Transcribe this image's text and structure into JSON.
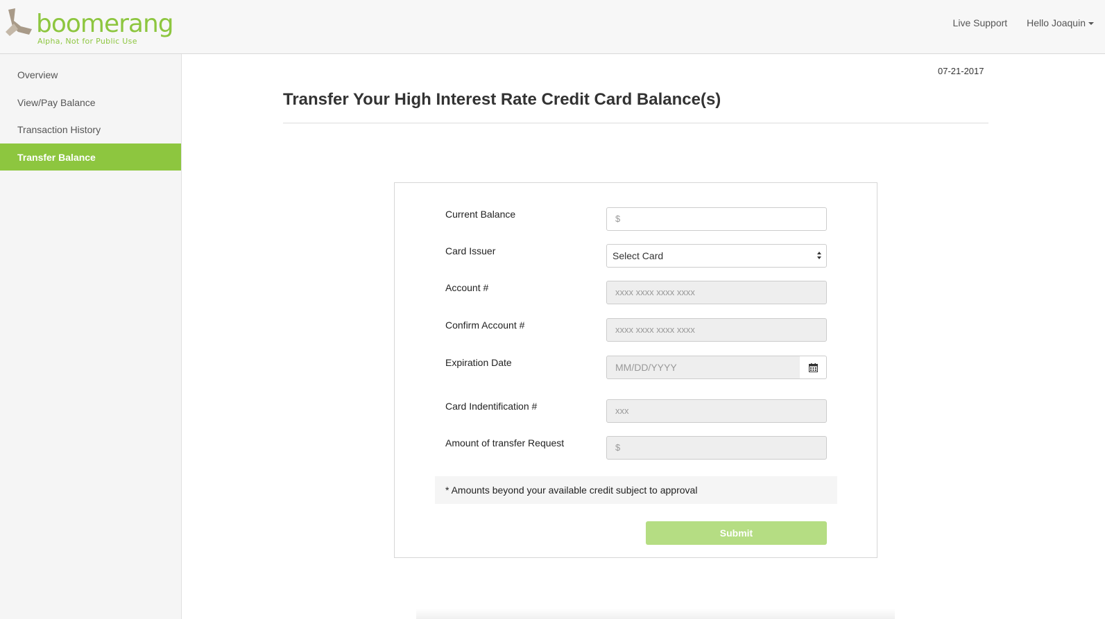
{
  "brand": {
    "name": "boomerang",
    "tagline": "Alpha, Not for Public Use"
  },
  "header": {
    "live_support": "Live Support",
    "user_greeting": "Hello Joaquin"
  },
  "sidebar": {
    "items": [
      {
        "label": "Overview",
        "active": false
      },
      {
        "label": "View/Pay Balance",
        "active": false
      },
      {
        "label": "Transaction History",
        "active": false
      },
      {
        "label": "Transfer Balance",
        "active": true
      }
    ]
  },
  "main": {
    "date": "07-21-2017",
    "title": "Transfer Your High Interest Rate Credit Card Balance(s)"
  },
  "form": {
    "current_balance": {
      "label": "Current Balance",
      "placeholder": "$"
    },
    "card_issuer": {
      "label": "Card Issuer",
      "selected": "Select Card"
    },
    "account": {
      "label": "Account #",
      "placeholder": "xxxx xxxx xxxx xxxx"
    },
    "confirm_account": {
      "label": "Confirm Account #",
      "placeholder": "xxxx xxxx xxxx xxxx"
    },
    "expiration": {
      "label": "Expiration Date",
      "placeholder": "MM/DD/YYYY"
    },
    "card_id": {
      "label": "Card Indentification #",
      "placeholder": "xxx"
    },
    "transfer_amount": {
      "label": "Amount of transfer Request",
      "placeholder": "$"
    },
    "note": "* Amounts beyond your available credit subject to approval",
    "submit_label": "Submit"
  },
  "colors": {
    "brand_green": "#8dc63f",
    "submit_disabled": "#b5dd83",
    "brand_taupe": "#a89a88"
  },
  "icons": {
    "logo": "boomerang-logo-icon",
    "calendar": "calendar-icon",
    "caret": "caret-down-icon",
    "select_arrows": "select-arrows-icon"
  }
}
